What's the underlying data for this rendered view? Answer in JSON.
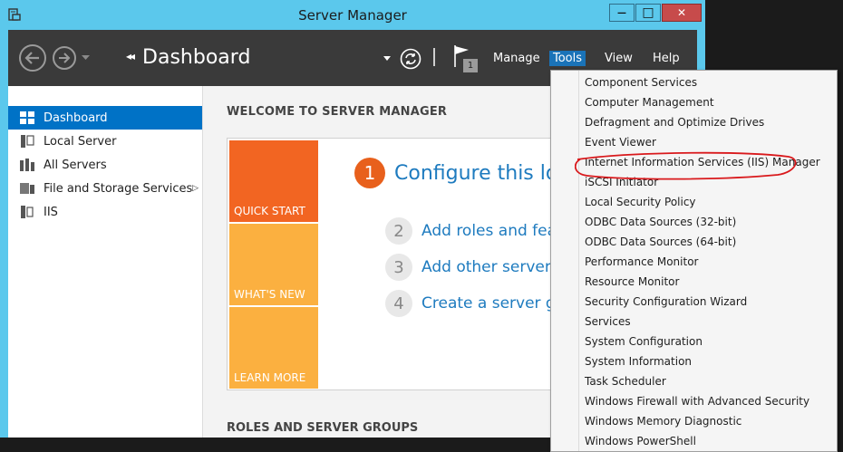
{
  "window": {
    "title": "Server Manager",
    "controls": {
      "minimize": "—",
      "maximize": "□",
      "close": "✕"
    }
  },
  "toolbar": {
    "breadcrumb_arrows": "◂◂",
    "breadcrumb": "Dashboard",
    "notification_count": "1",
    "menus": [
      "Manage",
      "Tools",
      "View",
      "Help"
    ],
    "active_menu": "Tools",
    "icons": [
      "back-arrow-icon",
      "forward-arrow-icon",
      "refresh-icon",
      "notification-flag-icon"
    ]
  },
  "sidebar": {
    "items": [
      {
        "label": "Dashboard",
        "icon": "dashboard-icon",
        "active": true
      },
      {
        "label": "Local Server",
        "icon": "server-icon"
      },
      {
        "label": "All Servers",
        "icon": "servers-icon"
      },
      {
        "label": "File and Storage Services",
        "icon": "storage-icon",
        "has_submenu": true
      },
      {
        "label": "IIS",
        "icon": "iis-icon"
      }
    ],
    "submenu_arrow": "▷"
  },
  "main": {
    "welcome_title": "WELCOME TO SERVER MANAGER",
    "tiles": [
      "QUICK START",
      "WHAT'S NEW",
      "LEARN MORE"
    ],
    "steps": [
      {
        "num": "1",
        "text": "Configure this lo"
      },
      {
        "num": "2",
        "text": "Add roles and fea"
      },
      {
        "num": "3",
        "text": "Add other servers"
      },
      {
        "num": "4",
        "text": "Create a server gr"
      }
    ],
    "roles_title": "ROLES AND SERVER GROUPS"
  },
  "tools_menu": {
    "items": [
      "Component Services",
      "Computer Management",
      "Defragment and Optimize Drives",
      "Event Viewer",
      "Internet Information Services (IIS) Manager",
      "iSCSI Initiator",
      "Local Security Policy",
      "ODBC Data Sources (32-bit)",
      "ODBC Data Sources (64-bit)",
      "Performance Monitor",
      "Resource Monitor",
      "Security Configuration Wizard",
      "Services",
      "System Configuration",
      "System Information",
      "Task Scheduler",
      "Windows Firewall with Advanced Security",
      "Windows Memory Diagnostic",
      "Windows PowerShell"
    ],
    "highlighted_item": "Internet Information Services (IIS) Manager"
  },
  "colors": {
    "title_bar": "#5bc8ec",
    "toolbar": "#3a3a3a",
    "selection": "#0072c6",
    "tile_quick_start": "#f26522",
    "tile_other": "#fbb040",
    "annotation": "#d9191c"
  }
}
